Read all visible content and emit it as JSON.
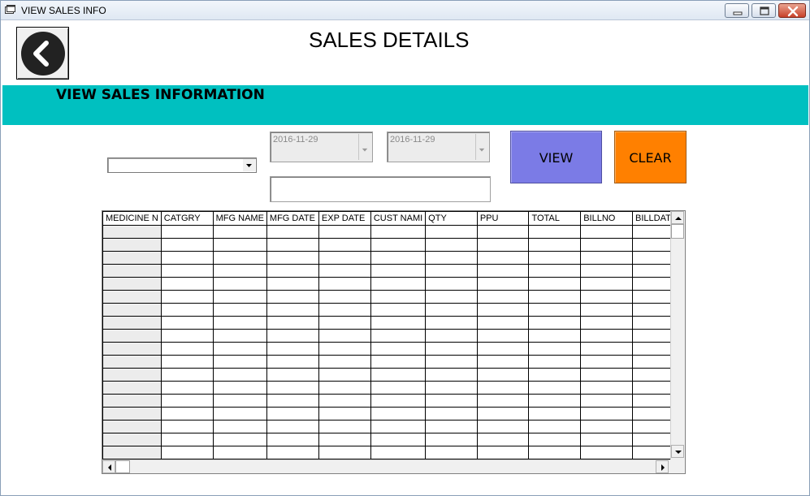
{
  "window": {
    "title": "VIEW SALES INFO"
  },
  "header": {
    "title": "SALES DETAILS"
  },
  "band": {
    "label": "VIEW SALES INFORMATION"
  },
  "filters": {
    "combo_value": "",
    "from_date": "2016-11-29",
    "to_date": "2016-11-29",
    "search_value": ""
  },
  "buttons": {
    "view_label": "VIEW",
    "clear_label": "CLEAR"
  },
  "grid": {
    "columns": [
      "MEDICINE NAME",
      "CATGRY",
      "MFG NAME",
      "MFG DATE",
      "EXP DATE",
      "CUST NAME",
      "QTY",
      "PPU",
      "TOTAL",
      "BILLNO",
      "BILLDATE"
    ],
    "visible_columns": [
      "MEDICINE N",
      "CATGRY",
      "MFG NAME",
      "MFG DATE",
      "EXP DATE",
      "CUST NAMI",
      "QTY",
      "PPU",
      "TOTAL",
      "BILLNO",
      "BILLDATE"
    ],
    "row_count": 18
  },
  "icons": {
    "back": "back-arrow-icon",
    "combo_arrow": "chevron-down-icon",
    "date_arrow": "chevron-down-icon"
  },
  "colors": {
    "band": "#00c0c0",
    "view_button": "#7b7be6",
    "clear_button": "#ff8000"
  }
}
